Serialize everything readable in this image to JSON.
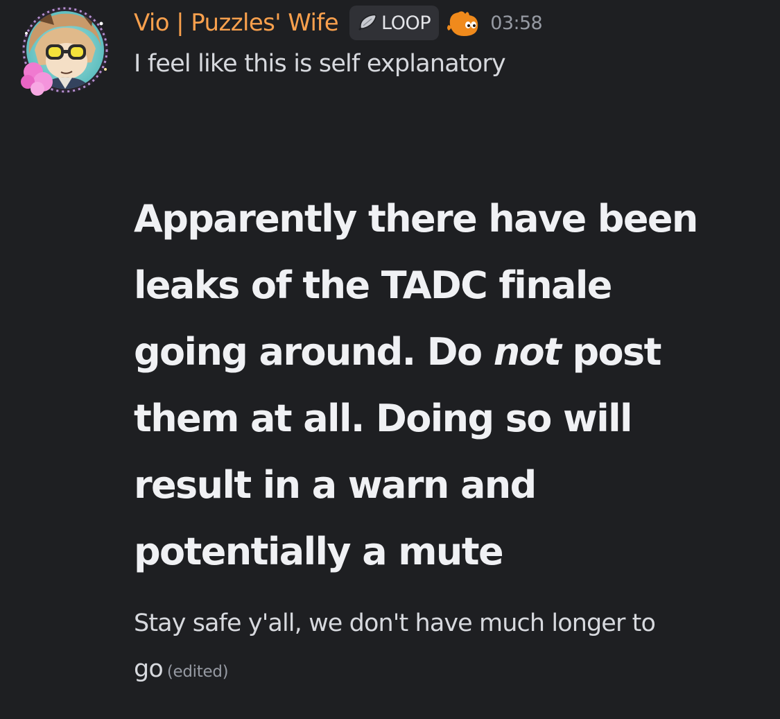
{
  "message": {
    "author": {
      "display_name": "Vio | Puzzles' Wife",
      "name_color": "#f9a04d",
      "avatar_icon": "character-avatar-icon"
    },
    "tag": {
      "icon": "feather-icon",
      "label": "LOOP"
    },
    "role_icon": "orange-ghost-icon",
    "timestamp": "03:58",
    "intro_text": "I feel like this is self explanatory",
    "heading": {
      "line1": "Apparently there have been",
      "line2": "leaks of the TADC finale",
      "line3_before": "going around. Do ",
      "line3_emphasis": "not",
      "line3_after": " post",
      "line4": "them at all. Doing so will",
      "line5": "result in a warn and",
      "line6": "potentially a mute"
    },
    "footer": {
      "line1": "Stay safe y'all, we don't have much longer to",
      "line2": "go"
    },
    "edited_label": "(edited)"
  },
  "colors": {
    "background": "#1e1f22",
    "text": "#d7d9de",
    "muted": "#969aa3",
    "tag_background": "#303136"
  }
}
